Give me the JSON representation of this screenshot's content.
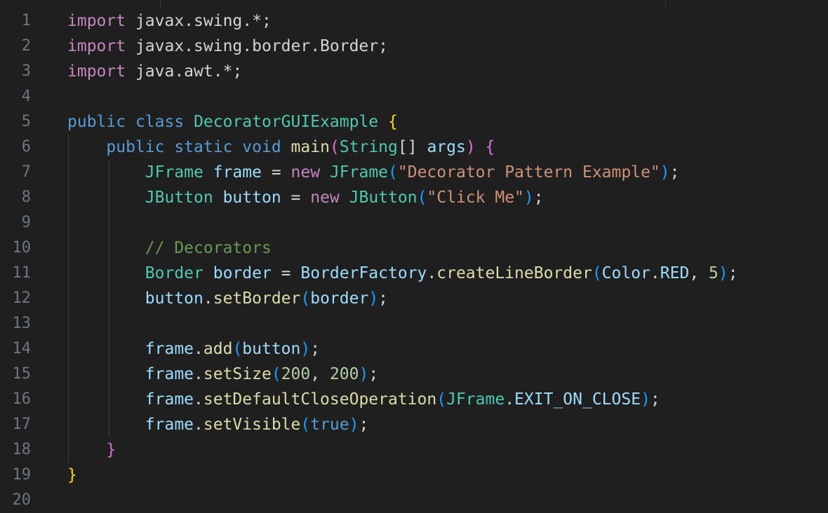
{
  "editor": {
    "line_numbers": [
      "1",
      "2",
      "3",
      "4",
      "5",
      "6",
      "7",
      "8",
      "9",
      "10",
      "11",
      "12",
      "13",
      "14",
      "15",
      "16",
      "17",
      "18",
      "19",
      "20"
    ],
    "lines": [
      [
        {
          "t": "import",
          "c": "kwc"
        },
        {
          "t": " javax.swing.*;",
          "c": "pl"
        }
      ],
      [
        {
          "t": "import",
          "c": "kwc"
        },
        {
          "t": " javax.swing.border.Border;",
          "c": "pl"
        }
      ],
      [
        {
          "t": "import",
          "c": "kwc"
        },
        {
          "t": " java.awt.*;",
          "c": "pl"
        }
      ],
      [],
      [
        {
          "t": "public",
          "c": "kw"
        },
        {
          "t": " ",
          "c": "pl"
        },
        {
          "t": "class",
          "c": "kw"
        },
        {
          "t": " ",
          "c": "pl"
        },
        {
          "t": "DecoratorGUIExample",
          "c": "ty"
        },
        {
          "t": " ",
          "c": "pl"
        },
        {
          "t": "{",
          "c": "b1"
        }
      ],
      [
        {
          "t": "    ",
          "c": "pl"
        },
        {
          "t": "public",
          "c": "kw"
        },
        {
          "t": " ",
          "c": "pl"
        },
        {
          "t": "static",
          "c": "kw"
        },
        {
          "t": " ",
          "c": "pl"
        },
        {
          "t": "void",
          "c": "kw"
        },
        {
          "t": " ",
          "c": "pl"
        },
        {
          "t": "main",
          "c": "fn"
        },
        {
          "t": "(",
          "c": "b2"
        },
        {
          "t": "String",
          "c": "ty"
        },
        {
          "t": "[] ",
          "c": "pl"
        },
        {
          "t": "args",
          "c": "var"
        },
        {
          "t": ")",
          "c": "b2"
        },
        {
          "t": " ",
          "c": "pl"
        },
        {
          "t": "{",
          "c": "b2"
        }
      ],
      [
        {
          "t": "        ",
          "c": "pl"
        },
        {
          "t": "JFrame",
          "c": "ty"
        },
        {
          "t": " ",
          "c": "pl"
        },
        {
          "t": "frame",
          "c": "var"
        },
        {
          "t": " = ",
          "c": "pl"
        },
        {
          "t": "new",
          "c": "kwc"
        },
        {
          "t": " ",
          "c": "pl"
        },
        {
          "t": "JFrame",
          "c": "ty"
        },
        {
          "t": "(",
          "c": "b3"
        },
        {
          "t": "\"Decorator Pattern Example\"",
          "c": "str"
        },
        {
          "t": ")",
          "c": "b3"
        },
        {
          "t": ";",
          "c": "pl"
        }
      ],
      [
        {
          "t": "        ",
          "c": "pl"
        },
        {
          "t": "JButton",
          "c": "ty"
        },
        {
          "t": " ",
          "c": "pl"
        },
        {
          "t": "button",
          "c": "var"
        },
        {
          "t": " = ",
          "c": "pl"
        },
        {
          "t": "new",
          "c": "kwc"
        },
        {
          "t": " ",
          "c": "pl"
        },
        {
          "t": "JButton",
          "c": "ty"
        },
        {
          "t": "(",
          "c": "b3"
        },
        {
          "t": "\"Click Me\"",
          "c": "str"
        },
        {
          "t": ")",
          "c": "b3"
        },
        {
          "t": ";",
          "c": "pl"
        }
      ],
      [],
      [
        {
          "t": "        ",
          "c": "pl"
        },
        {
          "t": "// Decorators",
          "c": "cmt"
        }
      ],
      [
        {
          "t": "        ",
          "c": "pl"
        },
        {
          "t": "Border",
          "c": "ty"
        },
        {
          "t": " ",
          "c": "pl"
        },
        {
          "t": "border",
          "c": "var"
        },
        {
          "t": " = ",
          "c": "pl"
        },
        {
          "t": "BorderFactory",
          "c": "var"
        },
        {
          "t": ".",
          "c": "pl"
        },
        {
          "t": "createLineBorder",
          "c": "fn"
        },
        {
          "t": "(",
          "c": "b3"
        },
        {
          "t": "Color",
          "c": "var"
        },
        {
          "t": ".",
          "c": "pl"
        },
        {
          "t": "RED",
          "c": "var"
        },
        {
          "t": ", ",
          "c": "pl"
        },
        {
          "t": "5",
          "c": "num"
        },
        {
          "t": ")",
          "c": "b3"
        },
        {
          "t": ";",
          "c": "pl"
        }
      ],
      [
        {
          "t": "        ",
          "c": "pl"
        },
        {
          "t": "button",
          "c": "var"
        },
        {
          "t": ".",
          "c": "pl"
        },
        {
          "t": "setBorder",
          "c": "fn"
        },
        {
          "t": "(",
          "c": "b3"
        },
        {
          "t": "border",
          "c": "var"
        },
        {
          "t": ")",
          "c": "b3"
        },
        {
          "t": ";",
          "c": "pl"
        }
      ],
      [],
      [
        {
          "t": "        ",
          "c": "pl"
        },
        {
          "t": "frame",
          "c": "var"
        },
        {
          "t": ".",
          "c": "pl"
        },
        {
          "t": "add",
          "c": "fn"
        },
        {
          "t": "(",
          "c": "b3"
        },
        {
          "t": "button",
          "c": "var"
        },
        {
          "t": ")",
          "c": "b3"
        },
        {
          "t": ";",
          "c": "pl"
        }
      ],
      [
        {
          "t": "        ",
          "c": "pl"
        },
        {
          "t": "frame",
          "c": "var"
        },
        {
          "t": ".",
          "c": "pl"
        },
        {
          "t": "setSize",
          "c": "fn"
        },
        {
          "t": "(",
          "c": "b3"
        },
        {
          "t": "200",
          "c": "num"
        },
        {
          "t": ", ",
          "c": "pl"
        },
        {
          "t": "200",
          "c": "num"
        },
        {
          "t": ")",
          "c": "b3"
        },
        {
          "t": ";",
          "c": "pl"
        }
      ],
      [
        {
          "t": "        ",
          "c": "pl"
        },
        {
          "t": "frame",
          "c": "var"
        },
        {
          "t": ".",
          "c": "pl"
        },
        {
          "t": "setDefaultCloseOperation",
          "c": "fn"
        },
        {
          "t": "(",
          "c": "b3"
        },
        {
          "t": "JFrame",
          "c": "ty"
        },
        {
          "t": ".",
          "c": "pl"
        },
        {
          "t": "EXIT_ON_CLOSE",
          "c": "var"
        },
        {
          "t": ")",
          "c": "b3"
        },
        {
          "t": ";",
          "c": "pl"
        }
      ],
      [
        {
          "t": "        ",
          "c": "pl"
        },
        {
          "t": "frame",
          "c": "var"
        },
        {
          "t": ".",
          "c": "pl"
        },
        {
          "t": "setVisible",
          "c": "fn"
        },
        {
          "t": "(",
          "c": "b3"
        },
        {
          "t": "true",
          "c": "kw"
        },
        {
          "t": ")",
          "c": "b3"
        },
        {
          "t": ";",
          "c": "pl"
        }
      ],
      [
        {
          "t": "    ",
          "c": "pl"
        },
        {
          "t": "}",
          "c": "b2"
        }
      ],
      [
        {
          "t": "}",
          "c": "b1"
        }
      ],
      []
    ]
  },
  "colors": {
    "background": "#1f1f1f",
    "line_number": "#6e7681",
    "keyword": "#569cd6",
    "control_keyword": "#c586c0",
    "type": "#4ec9b0",
    "function": "#dcdcaa",
    "variable": "#9cdcfe",
    "string": "#ce9178",
    "number": "#b5cea8",
    "comment": "#6a9955"
  }
}
